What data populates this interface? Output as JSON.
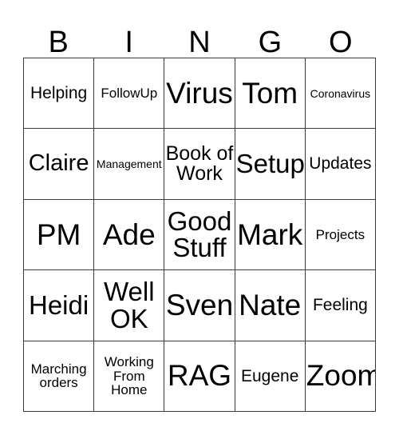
{
  "header": {
    "letters": [
      "B",
      "I",
      "N",
      "G",
      "O"
    ]
  },
  "grid": {
    "columns": 5,
    "rows": 5,
    "cells": [
      {
        "text": "Helping",
        "size": "sm"
      },
      {
        "text": "FollowUp",
        "size": "xs"
      },
      {
        "text": "Virus",
        "size": "xxl"
      },
      {
        "text": "Tom",
        "size": "xxl"
      },
      {
        "text": "Coronavirus",
        "size": "xxs"
      },
      {
        "text": "Claire",
        "size": "lg"
      },
      {
        "text": "Management",
        "size": "xxs"
      },
      {
        "text": "Book of\nWork",
        "size": "md"
      },
      {
        "text": "Setup",
        "size": "xl"
      },
      {
        "text": "Updates",
        "size": "sm"
      },
      {
        "text": "PM",
        "size": "xxl"
      },
      {
        "text": "Ade",
        "size": "xxl"
      },
      {
        "text": "Good\nStuff",
        "size": "xl"
      },
      {
        "text": "Mark",
        "size": "xxl"
      },
      {
        "text": "Projects",
        "size": "xs"
      },
      {
        "text": "Heidi",
        "size": "xl"
      },
      {
        "text": "Well\nOK",
        "size": "xl"
      },
      {
        "text": "Sven",
        "size": "xxl"
      },
      {
        "text": "Nate",
        "size": "xxl"
      },
      {
        "text": "Feeling",
        "size": "sm"
      },
      {
        "text": "Marching\norders",
        "size": "xs"
      },
      {
        "text": "Working\nFrom\nHome",
        "size": "xs"
      },
      {
        "text": "RAG",
        "size": "xxl"
      },
      {
        "text": "Eugene",
        "size": "sm"
      },
      {
        "text": "Zoom",
        "size": "xxl"
      }
    ]
  },
  "colors": {
    "background": "#ffffff",
    "text": "#000000",
    "border": "#3a3a3a"
  }
}
